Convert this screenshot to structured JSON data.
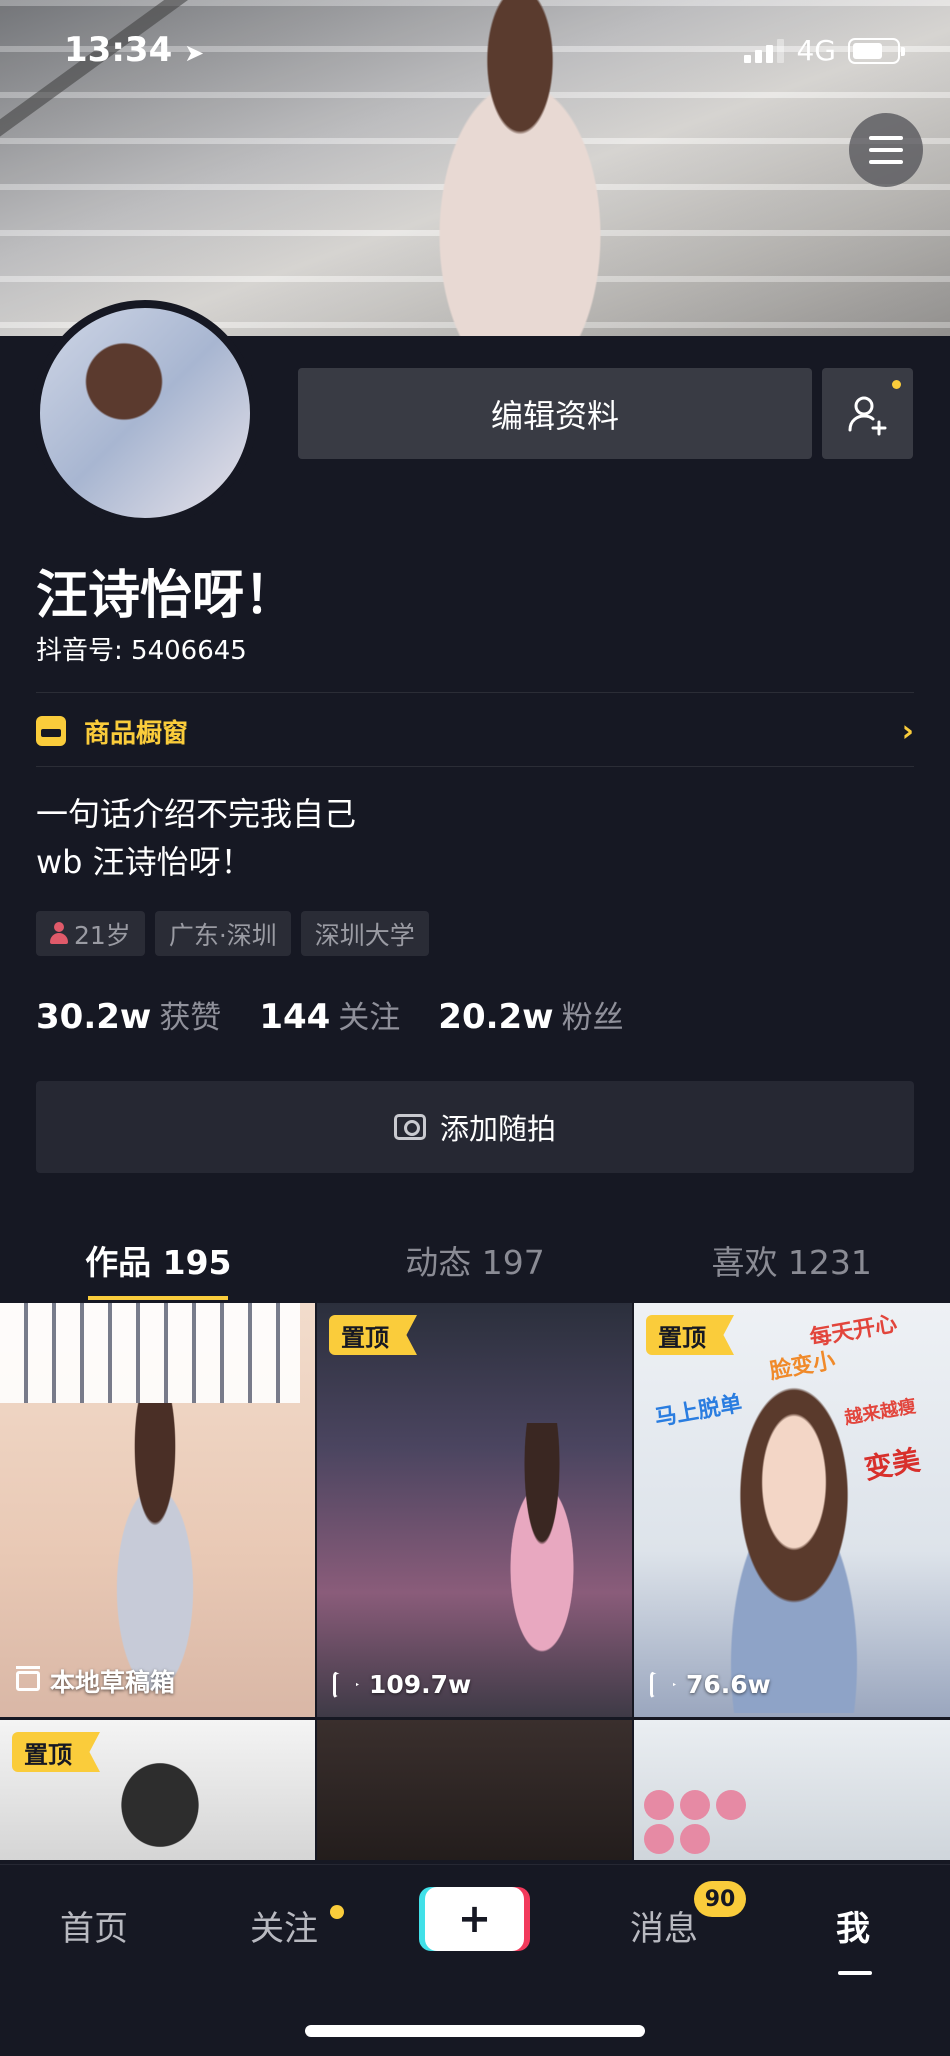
{
  "status_bar": {
    "time": "13:34",
    "network": "4G",
    "location_icon": "location-arrow-icon"
  },
  "profile": {
    "edit_label": "编辑资料",
    "name": "汪诗怡呀！",
    "douyin_id": "抖音号: 5406645",
    "shop_label": "商品橱窗",
    "bio_line1": "一句话介绍不完我自己",
    "bio_line2": "wb 汪诗怡呀！",
    "tags": [
      "21岁",
      "广东·深圳",
      "深圳大学"
    ]
  },
  "stats": [
    {
      "num": "30.2w",
      "label": "获赞"
    },
    {
      "num": "144",
      "label": "关注"
    },
    {
      "num": "20.2w",
      "label": "粉丝"
    }
  ],
  "add_photo_label": "添加随拍",
  "tabs": [
    "作品 195",
    "动态 197",
    "喜欢 1231"
  ],
  "grid": {
    "pin_label": "置顶",
    "draft_label": "本地草稿箱",
    "views": [
      "109.7w",
      "76.6w"
    ],
    "stickers": [
      "每天开心",
      "脸变小",
      "马上脱单",
      "越来越瘦",
      "变美"
    ]
  },
  "bottom_nav": {
    "home": "首页",
    "follow": "关注",
    "messages": "消息",
    "messages_badge": "90",
    "me": "我",
    "plus": "+"
  },
  "colors": {
    "accent": "#facc3b",
    "background": "#161823",
    "button": "#393b44"
  }
}
